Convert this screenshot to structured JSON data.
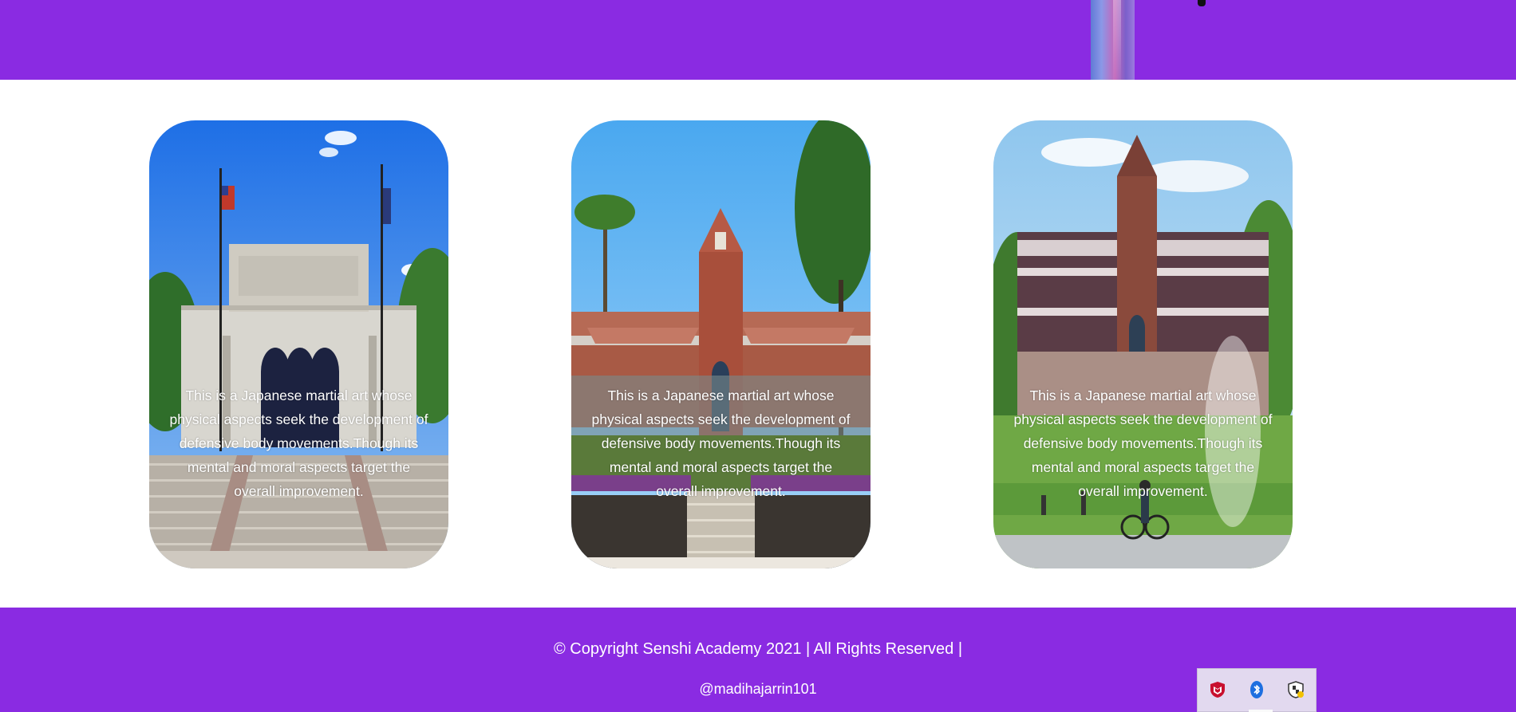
{
  "cards": [
    {
      "text": "This is a Japanese martial art whose physical aspects seek the development of defensive body movements.Though its mental and moral aspects target the overall improvement.",
      "photo": "museum-building-with-flags"
    },
    {
      "text": "This is a Japanese martial art whose physical aspects seek the development of defensive body movements.Though its mental and moral aspects target the overall improvement.",
      "photo": "brick-tower-building-with-palm-trees"
    },
    {
      "text": "This is a Japanese martial art whose physical aspects seek the development of defensive body movements.Though its mental and moral aspects target the overall improvement.",
      "photo": "campus-building-with-lawn-and-sprinkler"
    }
  ],
  "footer": {
    "copyright": "© Copyright Senshi Academy 2021 | All Rights Reserved |",
    "handle": "@madihajarrin101"
  },
  "tray": {
    "icons": [
      "mcafee-shield-icon",
      "bluetooth-icon",
      "security-shield-icon"
    ]
  },
  "colors": {
    "brand_purple": "#8a2be2",
    "card_text": "#ffffff",
    "tray_bg": "#e2d9ef"
  }
}
